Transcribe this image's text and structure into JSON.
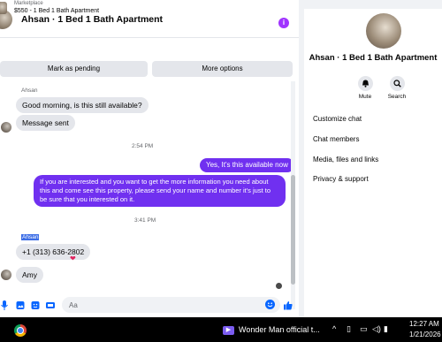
{
  "header": {
    "title": "Ahsan · 1 Bed 1 Bath Apartment",
    "info_icon": "i"
  },
  "listing": {
    "market_label": "Marketplace",
    "name": "$550 - 1 Bed 1 Bath Apartment"
  },
  "actions": {
    "pending": "Mark as pending",
    "more": "More options"
  },
  "messages": {
    "sender_1": "Ahsan",
    "m1": "Good morning, is this still available?",
    "m2": "Message sent",
    "ts1": "2:54 PM",
    "m3": "Yes, It's this available now",
    "m4": "If you are interested and you want to get the more information you need about this and come see this property, please send your name and number it's just to be sure that you interested on it.",
    "ts2": "3:41 PM",
    "sender_2": "Ahsan",
    "m5": "+1 (313) 636-2802",
    "reaction": "❤",
    "m6": "Amy"
  },
  "composer": {
    "placeholder": "Aa",
    "icons": [
      "microphone-icon",
      "image-icon",
      "sticker-icon",
      "gif-icon",
      "emoji-icon",
      "like-icon"
    ]
  },
  "info_panel": {
    "title": "Ahsan · 1 Bed 1 Bath Apartment",
    "mute_label": "Mute",
    "search_label": "Search",
    "links": [
      "Customize chat",
      "Chat members",
      "Media, files and links",
      "Privacy & support"
    ]
  },
  "taskbar": {
    "media_title": "Wonder Man official t...",
    "time": "12:27 AM",
    "date": "1/21/2026"
  },
  "colors": {
    "outgoing_bubble": "#7030f0",
    "accent": "#0866ff",
    "info_badge": "#a033ff"
  }
}
